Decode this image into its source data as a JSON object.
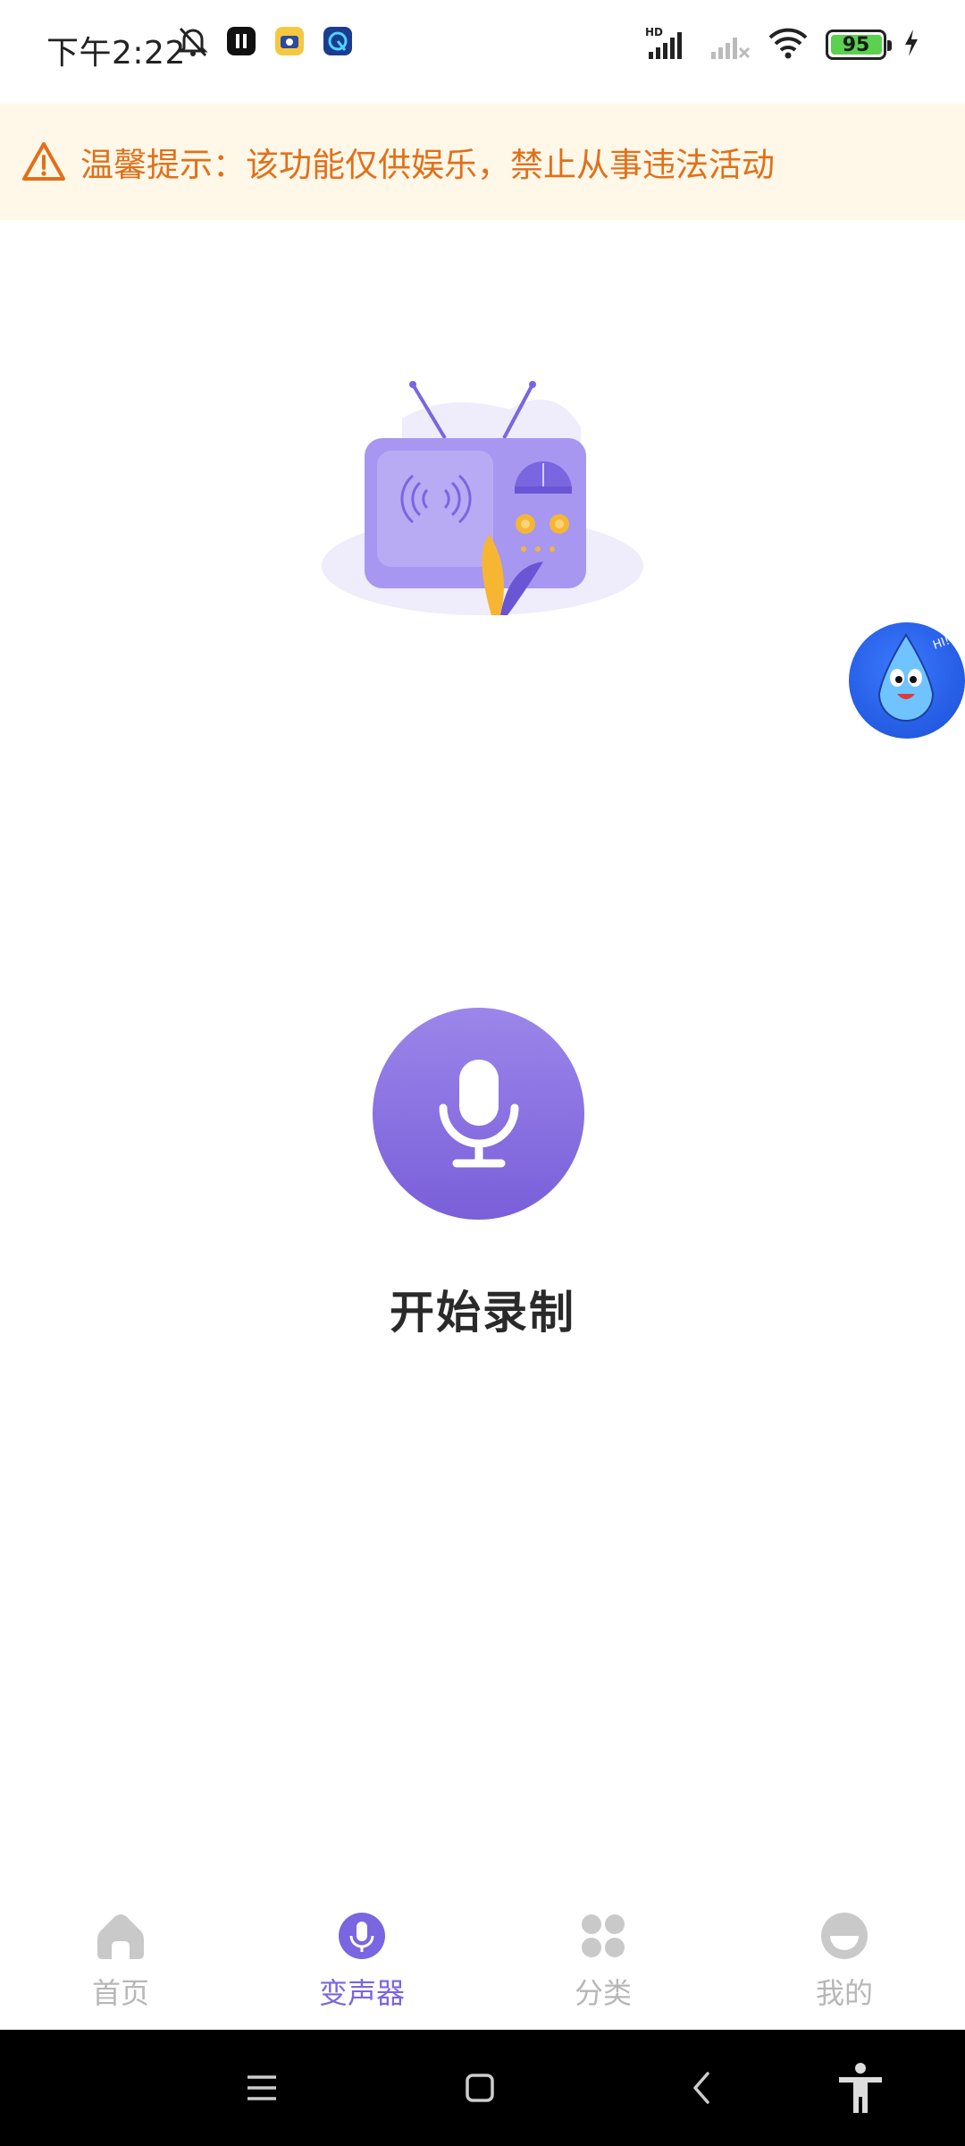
{
  "status_bar": {
    "time": "下午2:22",
    "battery_level": "95",
    "battery_fraction": 0.95,
    "network_badge": "HD"
  },
  "notice": {
    "text": "温馨提示：该功能仅供娱乐，禁止从事违法活动",
    "icon": "warning-icon",
    "color": "#e1701a"
  },
  "record": {
    "label": "开始录制",
    "icon": "microphone-icon",
    "accent": "#7a5fd9"
  },
  "bottom_nav": {
    "items": [
      {
        "label": "首页",
        "icon": "home-icon",
        "active": false
      },
      {
        "label": "变声器",
        "icon": "microphone-icon",
        "active": true
      },
      {
        "label": "分类",
        "icon": "category-icon",
        "active": false
      },
      {
        "label": "我的",
        "icon": "profile-icon",
        "active": false
      }
    ],
    "active_color": "#7a66e0",
    "inactive_color": "#b7b7b7"
  },
  "system_nav": {
    "buttons": [
      "menu-icon",
      "home-square-icon",
      "back-icon",
      "accessibility-icon"
    ]
  }
}
